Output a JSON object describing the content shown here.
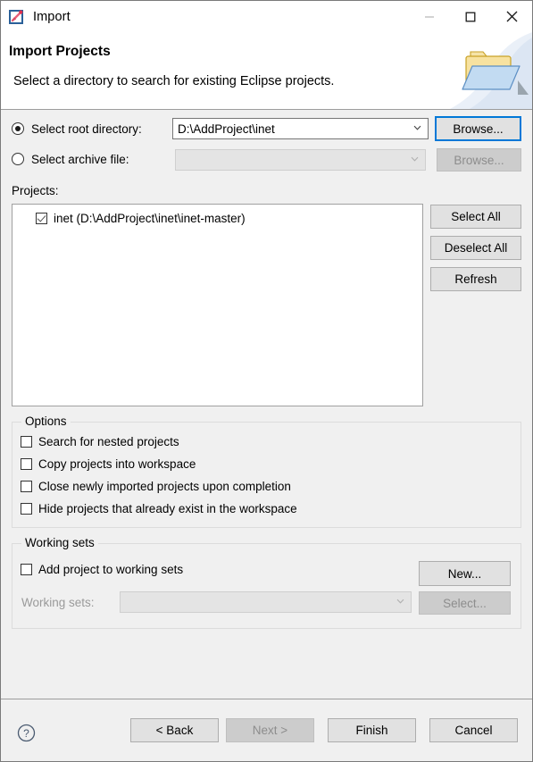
{
  "window": {
    "title": "Import",
    "icon": "import-icon",
    "controls": {
      "minimize": "–",
      "maximize": "□",
      "close": "✕"
    }
  },
  "header": {
    "title": "Import Projects",
    "description": "Select a directory to search for existing Eclipse projects.",
    "art_icon": "open-folder-icon"
  },
  "source": {
    "root_directory": {
      "radio_label": "Select root directory:",
      "selected": true,
      "value": "D:\\AddProject\\inet",
      "placeholder": "",
      "browse_label": "Browse...",
      "browse_focused": true,
      "enabled": true
    },
    "archive_file": {
      "radio_label": "Select archive file:",
      "selected": false,
      "value": "",
      "placeholder": "",
      "browse_label": "Browse...",
      "browse_focused": false,
      "enabled": false
    }
  },
  "projects": {
    "label": "Projects:",
    "items": [
      {
        "label": "inet (D:\\AddProject\\inet\\inet-master)",
        "checked": true
      }
    ],
    "buttons": {
      "select_all": "Select All",
      "deselect_all": "Deselect All",
      "refresh": "Refresh"
    }
  },
  "options": {
    "title": "Options",
    "items": [
      {
        "label": "Search for nested projects",
        "checked": false
      },
      {
        "label": "Copy projects into workspace",
        "checked": false
      },
      {
        "label": "Close newly imported projects upon completion",
        "checked": false
      },
      {
        "label": "Hide projects that already exist in the workspace",
        "checked": false
      }
    ]
  },
  "working_sets": {
    "title": "Working sets",
    "add_checkbox": {
      "label": "Add project to working sets",
      "checked": false
    },
    "new_button": "New...",
    "combo_label": "Working sets:",
    "combo_value": "",
    "combo_enabled": false,
    "select_button": "Select...",
    "select_enabled": false
  },
  "footer": {
    "help_icon": "help-icon",
    "back": "< Back",
    "next": "Next >",
    "next_enabled": false,
    "finish": "Finish",
    "cancel": "Cancel"
  },
  "colors": {
    "accent": "#0078d7",
    "dialog_bg": "#f0f0f0",
    "button_bg": "#e1e1e1",
    "disabled_text": "#8d8d8d"
  }
}
